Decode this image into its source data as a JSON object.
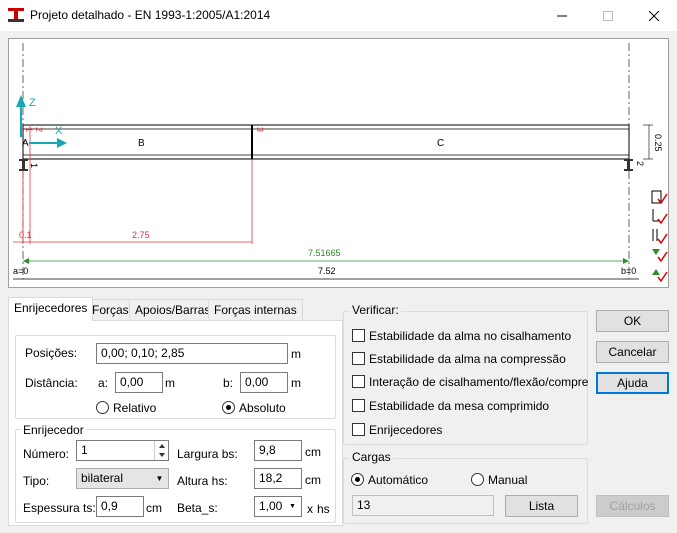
{
  "window": {
    "title": "Projeto detalhado - EN 1993-1:2005/A1:2014"
  },
  "diagram": {
    "axis_z": "Z",
    "axis_x": "X",
    "support_left": "A",
    "segment_b": "B",
    "segment_c": "C",
    "height_dim": "0.25",
    "red_labels": [
      "1",
      "2",
      "3"
    ],
    "node_left": "1",
    "node_right": "2",
    "dim_red_1": "0.1",
    "dim_red_2": "2.75",
    "dim_green": "7.51665",
    "dim_total": "7.52",
    "a_label": "a=0",
    "b_label": "b=0"
  },
  "tabs": [
    "Enrijecedores",
    "Forças",
    "Apoios/Barras",
    "Forças internas"
  ],
  "stiffeners": {
    "positions_label": "Posições:",
    "positions_value": "0,00; 0,10; 2,85",
    "positions_unit": "m",
    "distance_label": "Distância:",
    "a_label": "a:",
    "a_value": "0,00",
    "a_unit": "m",
    "b_label": "b:",
    "b_value": "0,00",
    "b_unit": "m",
    "relative_label": "Relativo",
    "absolute_label": "Absoluto",
    "absolute_selected": true
  },
  "stiffener": {
    "group_title": "Enrijecedor",
    "number_label": "Número:",
    "number_value": "1",
    "width_label": "Largura bs:",
    "width_value": "9,8",
    "width_unit": "cm",
    "type_label": "Tipo:",
    "type_value": "bilateral",
    "height_label": "Altura hs:",
    "height_value": "18,2",
    "height_unit": "cm",
    "thickness_label": "Espessura ts:",
    "thickness_value": "0,9",
    "thickness_unit": "cm",
    "beta_label": "Beta_s:",
    "beta_value": "1,00",
    "beta_unit": "x",
    "beta_unit2": "hs"
  },
  "verify": {
    "title": "Verificar:",
    "items": [
      {
        "label": "Estabilidade da alma no cisalhamento",
        "checked": false
      },
      {
        "label": "Estabilidade da alma na compressão",
        "checked": false
      },
      {
        "label": "Interação de cisalhamento/flexão/compressão",
        "checked": false
      },
      {
        "label": "Estabilidade da mesa comprimido",
        "checked": false
      },
      {
        "label": "Enrijecedores",
        "checked": false
      }
    ]
  },
  "loads": {
    "title": "Cargas",
    "auto_label": "Automático",
    "manual_label": "Manual",
    "auto_selected": true,
    "value": "13",
    "list_button": "Lista"
  },
  "buttons": {
    "ok": "OK",
    "cancel": "Cancelar",
    "help": "Ajuda",
    "calc": "Cálculos"
  },
  "colors": {
    "red_dim": "#e8333a",
    "green_dim": "#2e8b2e",
    "axis_teal": "#17a9b3",
    "accent_blue": "#0078d7"
  }
}
